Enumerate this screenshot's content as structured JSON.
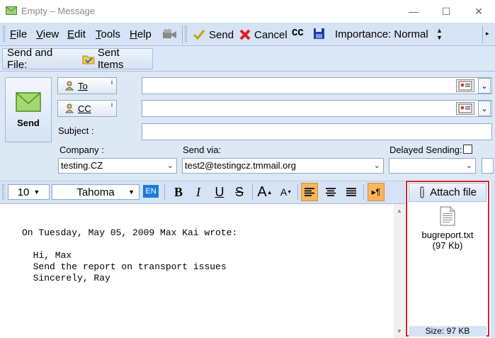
{
  "window": {
    "title": "Empty – Message",
    "minimize": "—",
    "maximize": "☐",
    "close": "✕"
  },
  "menu": {
    "items": [
      {
        "label": "File",
        "underline": "F"
      },
      {
        "label": "View",
        "underline": "V"
      },
      {
        "label": "Edit",
        "underline": "E"
      },
      {
        "label": "Tools",
        "underline": "T"
      },
      {
        "label": "Help",
        "underline": "H"
      }
    ]
  },
  "toolbar": {
    "send_label": "Send",
    "cancel_label": "Cancel",
    "cc_label": "CC",
    "importance_label": "Importance: Normal"
  },
  "toolbar2": {
    "send_and_file_label": "Send and File:",
    "sent_items_label": "Sent Items"
  },
  "compose": {
    "send_button_label": "Send",
    "to_label": "To",
    "cc_label": "CC",
    "subject_label": "Subject :",
    "company_label": "Company :",
    "company_value": "testing.CZ",
    "send_via_label": "Send via:",
    "send_via_value": "test2@testingcz.tmmail.org",
    "delayed_sending_label": "Delayed Sending:",
    "delayed_sending_value": ""
  },
  "format": {
    "font_size": "10",
    "font_name": "Tahoma",
    "lang": "EN"
  },
  "body": {
    "lines": [
      "On Tuesday, May 05, 2009 Max Kai wrote:",
      "",
      "  Hi, Max",
      "  Send the report on transport issues",
      "  Sincerely, Ray"
    ]
  },
  "attachments": {
    "button_label": "Attach file",
    "files": [
      {
        "name": "bugreport.txt",
        "size": "(97 Kb)"
      }
    ],
    "total_size": "Size: 97 KB"
  },
  "colors": {
    "toolbar_bg": "#d5e3f4",
    "highlight": "#d9232d",
    "active_format": "#f7b55e"
  }
}
